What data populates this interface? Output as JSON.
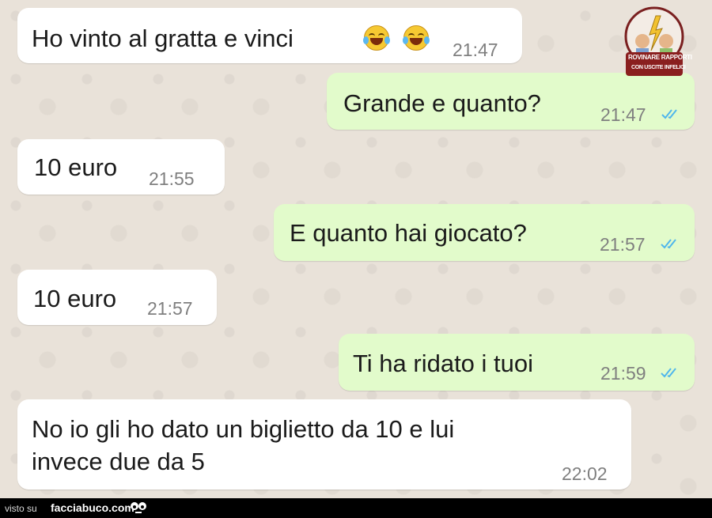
{
  "messages": [
    {
      "direction": "in",
      "text": "Ho vinto al gratta e vinci",
      "time": "21:47",
      "emoji": "face-with-tears-of-joy-icon x2"
    },
    {
      "direction": "out",
      "text": "Grande e quanto?",
      "time": "21:47",
      "status": "read"
    },
    {
      "direction": "in",
      "text": "10 euro",
      "time": "21:55"
    },
    {
      "direction": "out",
      "text": "E quanto hai giocato?",
      "time": "21:57",
      "status": "read"
    },
    {
      "direction": "in",
      "text": "10 euro",
      "time": "21:57"
    },
    {
      "direction": "out",
      "text": "Ti ha ridato i tuoi",
      "time": "21:59",
      "status": "read"
    },
    {
      "direction": "in",
      "lines": [
        "No io gli ho dato un biglietto da 10 e lui",
        "invece due da 5"
      ],
      "time": "22:02"
    }
  ],
  "watermark": {
    "line1": "ROVINARE RAPPORTI",
    "line2": "CON USCITE INFELICI"
  },
  "footer": {
    "prefix": "visto su",
    "site": "facciabuco.com"
  },
  "colors": {
    "incoming": "#ffffff",
    "outgoing": "#e2fbcb",
    "background": "#e9e2d9",
    "read_ticks": "#4fb6ec"
  }
}
